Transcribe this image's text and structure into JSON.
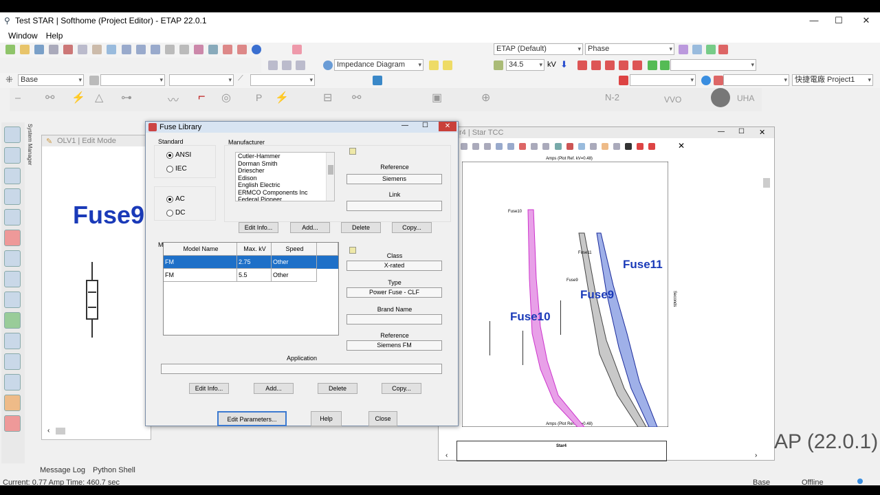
{
  "window": {
    "title": "Test STAR | Softhome (Project Editor) - ETAP 22.0.1"
  },
  "menu": {
    "items": [
      "Window",
      "Help"
    ]
  },
  "toolbar": {
    "preset": "ETAP (Default)",
    "phase": "Phase",
    "diagram": "Impedance Diagram",
    "kv_value": "34.5",
    "kv_unit": "kV",
    "base": "Base",
    "project": "快捷電廠 Project1",
    "element_labels": [
      "P",
      "N-2",
      "VVO",
      "UHA"
    ]
  },
  "system_manager": "System Manager",
  "olv": {
    "title": "OLV1 | Edit Mode",
    "fuse_label": "Fuse9"
  },
  "dialog": {
    "title": "Fuse Library",
    "standard_label": "Standard",
    "standards": [
      "ANSI",
      "IEC"
    ],
    "standard_selected": "ANSI",
    "current_types": [
      "AC",
      "DC"
    ],
    "current_selected": "AC",
    "manufacturer_label": "Manufacturer",
    "manufacturers": [
      "Cutler-Hammer",
      "Dorman Smith",
      "Driescher",
      "Edison",
      "English Electric",
      "ERMCO Components Inc",
      "Federal Pioneer"
    ],
    "mfr_reference_label": "Reference",
    "mfr_reference": "Siemens",
    "link_label": "Link",
    "link": "",
    "mfr_buttons": [
      "Edit Info...",
      "Add...",
      "Delete",
      "Copy..."
    ],
    "model_label": "Model",
    "table_headers": [
      "Model Name",
      "Max. kV",
      "Speed"
    ],
    "rows": [
      {
        "model": "FM",
        "kv": "2.75",
        "speed": "Other"
      },
      {
        "model": "FM",
        "kv": "5.5",
        "speed": "Other"
      }
    ],
    "class_label": "Class",
    "class": "X-rated",
    "type_label": "Type",
    "type": "Power Fuse - CLF",
    "brand_label": "Brand Name",
    "brand": "",
    "model_reference_label": "Reference",
    "model_reference": "Siemens FM",
    "application_label": "Application",
    "application": "",
    "model_buttons": [
      "Edit Info...",
      "Add...",
      "Delete",
      "Copy..."
    ],
    "bottom_buttons": [
      "Edit Parameters...",
      "Help",
      "Close"
    ]
  },
  "tcc": {
    "title": "r4 | Star TCC",
    "axis_top": "Amps (Plot Ref. kV=0.48)",
    "axis_bottom": "Amps (Plot Ref. kV=0.48)",
    "axis_right": "Seconds",
    "curve_labels": [
      "Fuse10",
      "Fuse9",
      "Fuse11"
    ],
    "small_labels": [
      "Fuse10",
      "Fuse11",
      "Fuse9"
    ],
    "footer_name": "Star4",
    "colors": {
      "fuse10": "#cc33cc",
      "fuse9": "#444444",
      "fuse11": "#1a2a9a"
    }
  },
  "watermark": "AP (22.0.1)",
  "tabs": [
    "Message Log",
    "Python Shell"
  ],
  "status": {
    "left": "Current: 0.77 Amp  Time: 460.7 sec",
    "base": "Base",
    "mode": "Offline"
  }
}
